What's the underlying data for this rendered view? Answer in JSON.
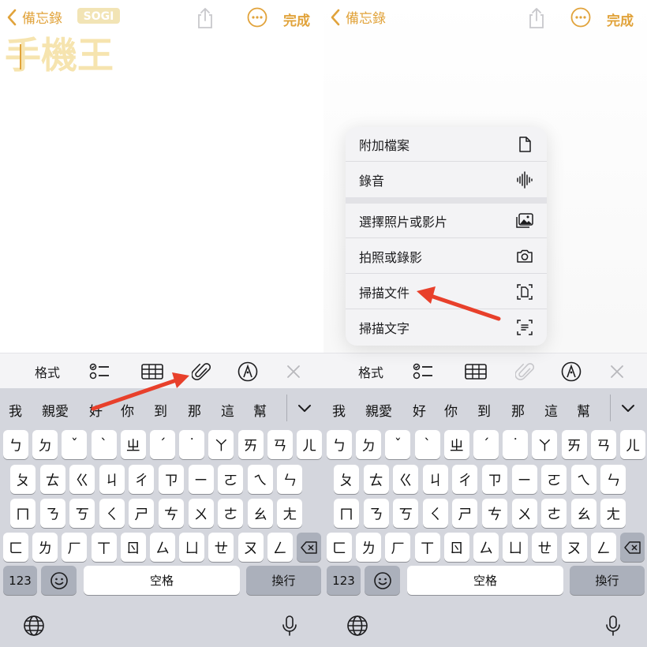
{
  "nav": {
    "back_label": "備忘錄",
    "done_label": "完成"
  },
  "watermark": {
    "brand": "SOGI",
    "logo": "手機王"
  },
  "toolbar": {
    "format_label": "格式"
  },
  "candidates": [
    "我",
    "親愛",
    "好",
    "你",
    "到",
    "那",
    "這",
    "幫"
  ],
  "keyboard": {
    "row1": [
      "ㄅ",
      "ㄉ",
      "ˇ",
      "ˋ",
      "ㄓ",
      "ˊ",
      "˙",
      "ㄚ",
      "ㄞ",
      "ㄢ",
      "ㄦ"
    ],
    "row2": [
      "ㄆ",
      "ㄊ",
      "ㄍ",
      "ㄐ",
      "ㄔ",
      "ㄗ",
      "ㄧ",
      "ㄛ",
      "ㄟ",
      "ㄣ"
    ],
    "row3": [
      "ㄇ",
      "ㄋ",
      "ㄎ",
      "ㄑ",
      "ㄕ",
      "ㄘ",
      "ㄨ",
      "ㄜ",
      "ㄠ",
      "ㄤ"
    ],
    "row4": [
      "ㄈ",
      "ㄌ",
      "ㄏ",
      "ㄒ",
      "ㄖ",
      "ㄙ",
      "ㄩ",
      "ㄝ",
      "ㄡ",
      "ㄥ"
    ],
    "numbers_label": "123",
    "space_label": "空格",
    "return_label": "換行"
  },
  "attach_menu": {
    "items": [
      {
        "label": "附加檔案",
        "icon": "document-icon"
      },
      {
        "label": "錄音",
        "icon": "waveform-icon"
      },
      {
        "label": "選擇照片或影片",
        "icon": "photo-library-icon"
      },
      {
        "label": "拍照或錄影",
        "icon": "camera-icon"
      },
      {
        "label": "掃描文件",
        "icon": "scan-document-icon"
      },
      {
        "label": "掃描文字",
        "icon": "scan-text-icon"
      }
    ]
  },
  "colors": {
    "accent": "#e1a33b",
    "arrow": "#e8402b",
    "keyboard_bg": "#d4d6dd",
    "toolbar_bg": "#f4f4f6"
  }
}
